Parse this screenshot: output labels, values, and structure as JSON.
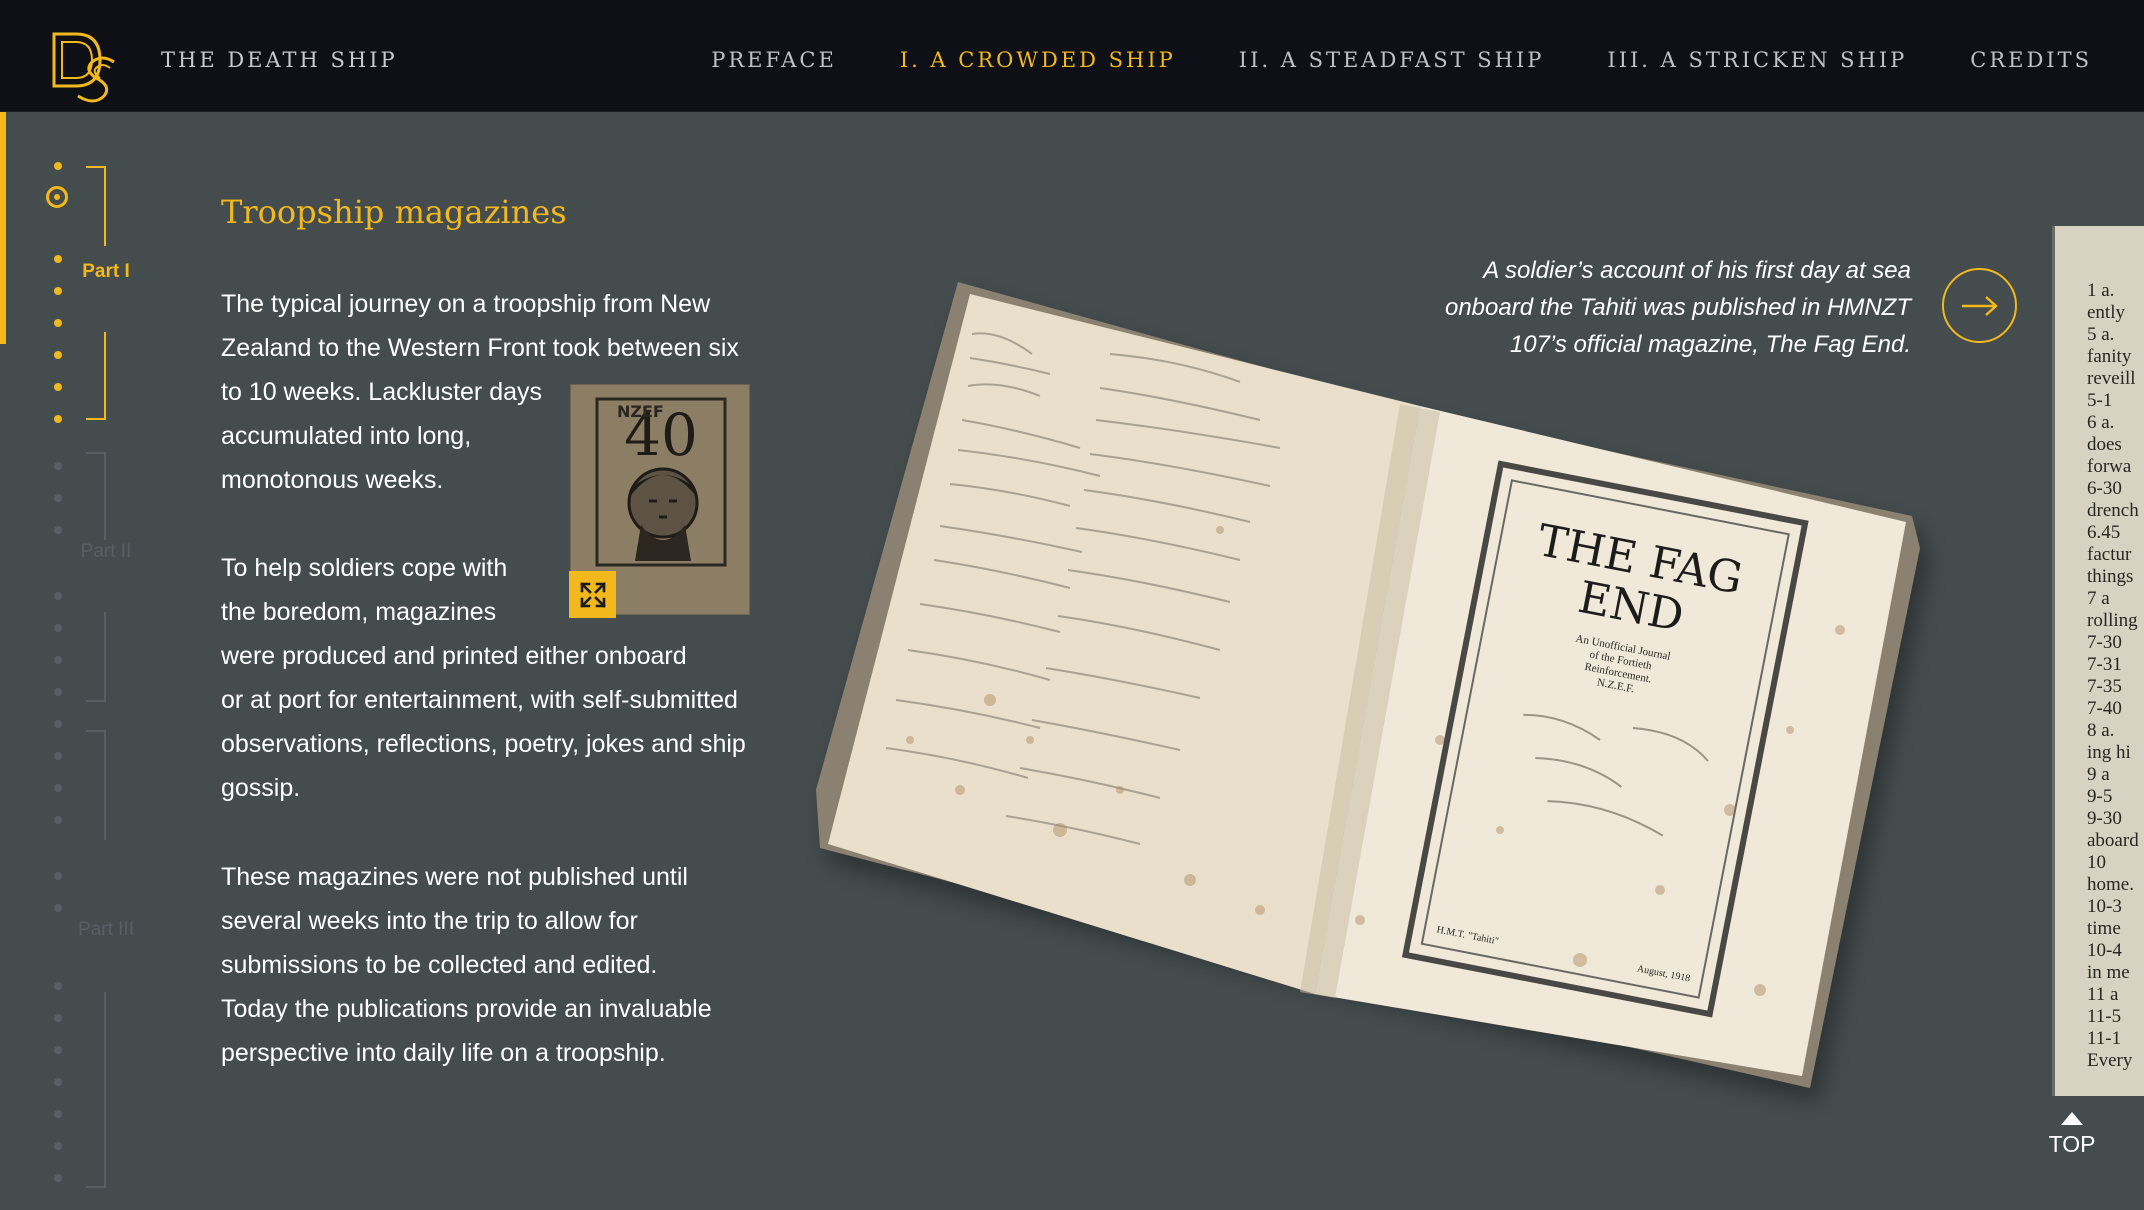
{
  "header": {
    "logo_text": "DS",
    "site_title": "THE DEATH SHIP",
    "nav": [
      {
        "label": "PREFACE",
        "active": false
      },
      {
        "label": "I. A CROWDED SHIP",
        "active": true
      },
      {
        "label": "II. A STEADFAST SHIP",
        "active": false
      },
      {
        "label": "III. A STRICKEN SHIP",
        "active": false
      },
      {
        "label": "CREDITS",
        "active": false
      }
    ]
  },
  "rail": {
    "parts": [
      {
        "label": "Part I",
        "active": true
      },
      {
        "label": "Part II",
        "active": false
      },
      {
        "label": "Part III",
        "active": false
      }
    ]
  },
  "article": {
    "title": "Troopship magazines",
    "paragraphs": [
      [
        "The typical journey on a troopship from New",
        "Zealand to the Western Front took between six",
        "to 10 weeks. Lackluster days",
        "accumulated into long,",
        "monotonous weeks."
      ],
      [
        "To help soldiers cope with",
        "the boredom, magazines",
        "were produced and printed either onboard",
        "or at port for entertainment, with self-submitted",
        "observations, reflections, poetry, jokes and ship",
        "gossip."
      ],
      [
        "These magazines were not published until",
        "several weeks into the trip to allow for",
        "submissions to be collected and edited.",
        "Today the publications provide an invaluable",
        "perspective into daily life on a troopship."
      ]
    ],
    "thumbnail": {
      "cover_number": "40",
      "cover_mark": "NZEF"
    }
  },
  "feature": {
    "caption": [
      "A soldier’s account of his first day at sea",
      "onboard the Tahiti was published in HMNZT",
      "107’s official magazine, The Fag End."
    ],
    "book": {
      "title_line1": "THE FAG",
      "title_line2": "END",
      "subtitle": [
        "An Unofficial Journal",
        "of the Fortieth",
        "Reinforcement.",
        "N.Z.E.F."
      ],
      "footer_left": "H.M.T. \"Tahiti\"",
      "footer_right": "August, 1918"
    },
    "peek_lines": [
      "1 a.",
      "ently",
      "5 a.",
      "fanity",
      "reveill",
      "5-1",
      "6 a.",
      "does",
      "forwa",
      "6-30",
      "drench",
      "6.45",
      "factur",
      "things",
      "7 a",
      "rolling",
      "7-30",
      "7-31",
      "7-35",
      "7-40",
      "8 a.",
      "ing hi",
      "9 a",
      "9-5",
      "9-30",
      "aboard",
      "10",
      "home.",
      "10-3",
      "time",
      "10-4",
      "in me",
      "11 a",
      "11-5",
      "11-1",
      "Every"
    ]
  },
  "top_button": {
    "label": "TOP"
  },
  "colors": {
    "accent": "#f2b81c",
    "background": "#444c4e",
    "header": "#0e1015"
  },
  "icons": {
    "expand": "expand-icon",
    "next": "arrow-right-icon",
    "top": "chevron-up-icon"
  }
}
